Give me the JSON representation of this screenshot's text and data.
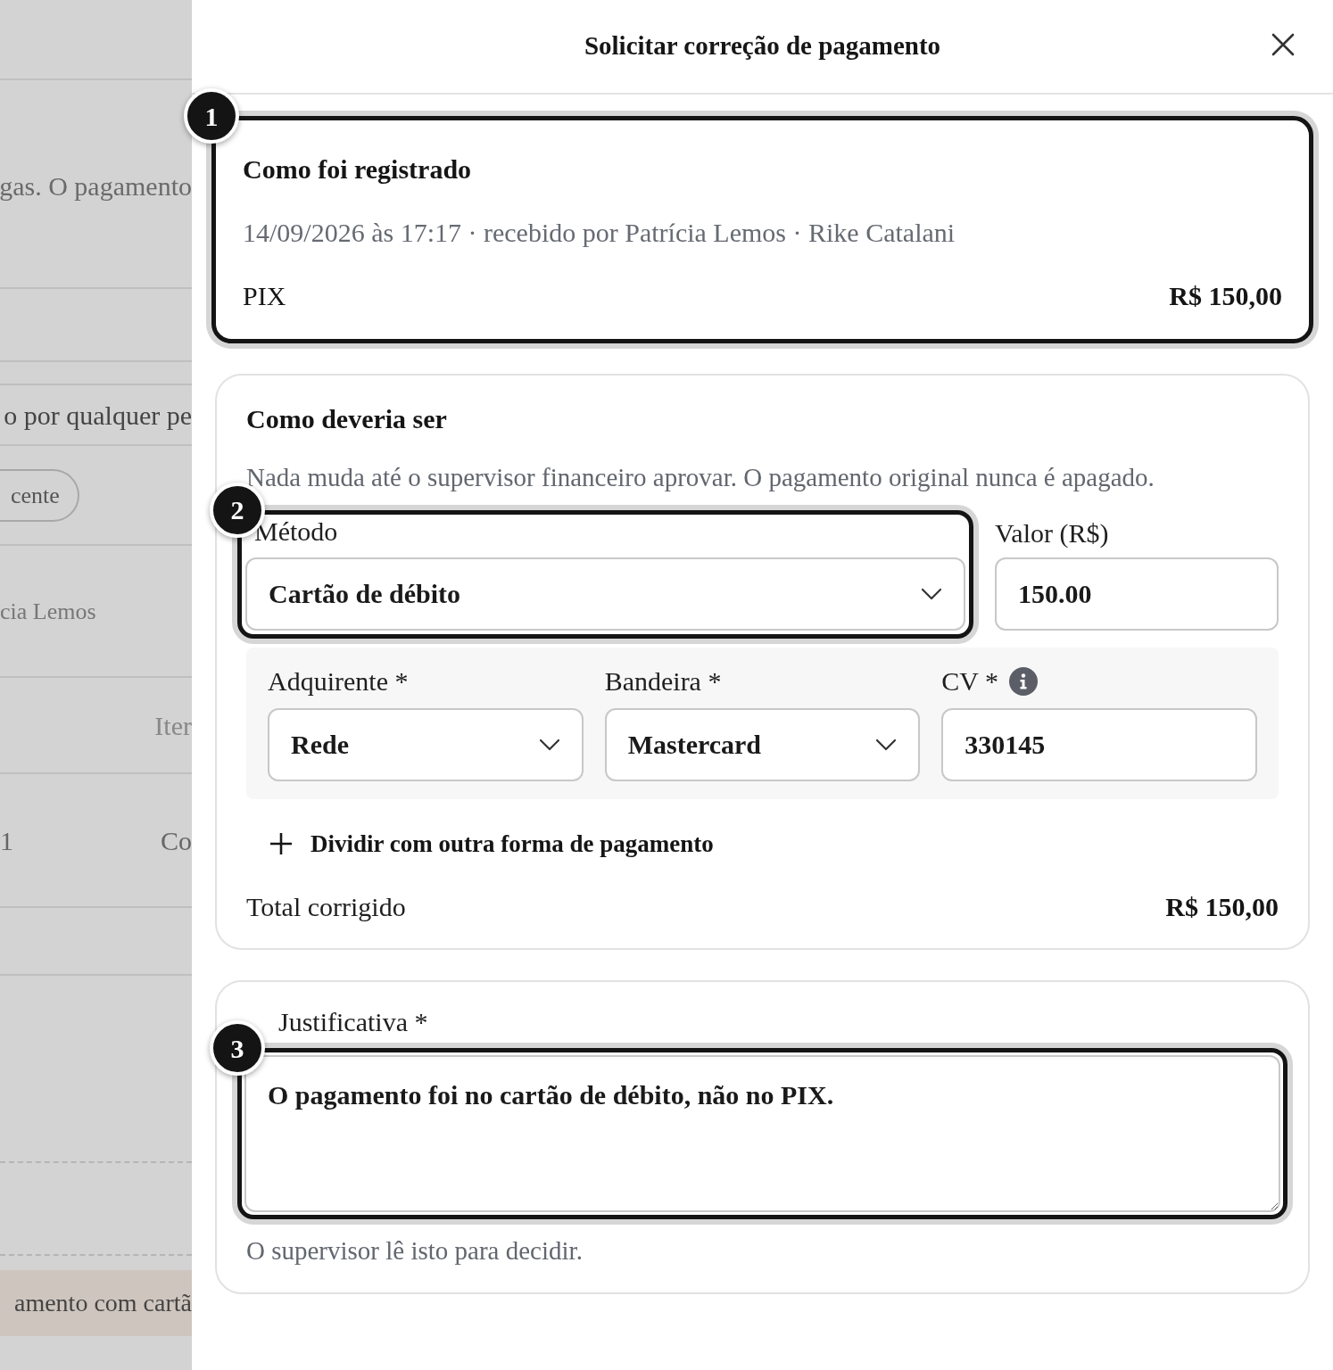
{
  "background_page": {
    "paragraph": "gas. O pagamento",
    "notice": "o por qualquer pe",
    "chip": "cente",
    "meta": "cia Lemos",
    "column_header": "Iter",
    "row_cells": [
      "1",
      "Co"
    ],
    "highlight_row": "amento com cartã"
  },
  "dialog": {
    "title": "Solicitar correção de pagamento"
  },
  "recorded": {
    "badge": "1",
    "heading": "Como foi registrado",
    "meta": "14/09/2026 às 17:17 · recebido por Patrícia Lemos · Rike Catalani",
    "method": "PIX",
    "amount": "R$ 150,00"
  },
  "correction": {
    "heading": "Como deveria ser",
    "note": "Nada muda até o supervisor financeiro aprovar. O pagamento original nunca é apagado.",
    "method_field": {
      "badge": "2",
      "label": "Método",
      "value": "Cartão de débito"
    },
    "amount_field": {
      "label": "Valor (R$)",
      "value": "150.00"
    },
    "card_details": [
      {
        "kind": "select",
        "label": "Adquirente *",
        "value": "Rede",
        "info": false
      },
      {
        "kind": "select",
        "label": "Bandeira *",
        "value": "Mastercard",
        "info": false
      },
      {
        "kind": "input",
        "label": "CV *",
        "value": "330145",
        "info": true
      }
    ],
    "split_button": "Dividir com outra forma de pagamento",
    "total_label": "Total corrigido",
    "total_value": "R$ 150,00"
  },
  "justification": {
    "badge": "3",
    "label": "Justificativa *",
    "value": "O pagamento foi no cartão de débito, não no PIX.",
    "help": "O supervisor lê isto para decidir."
  }
}
